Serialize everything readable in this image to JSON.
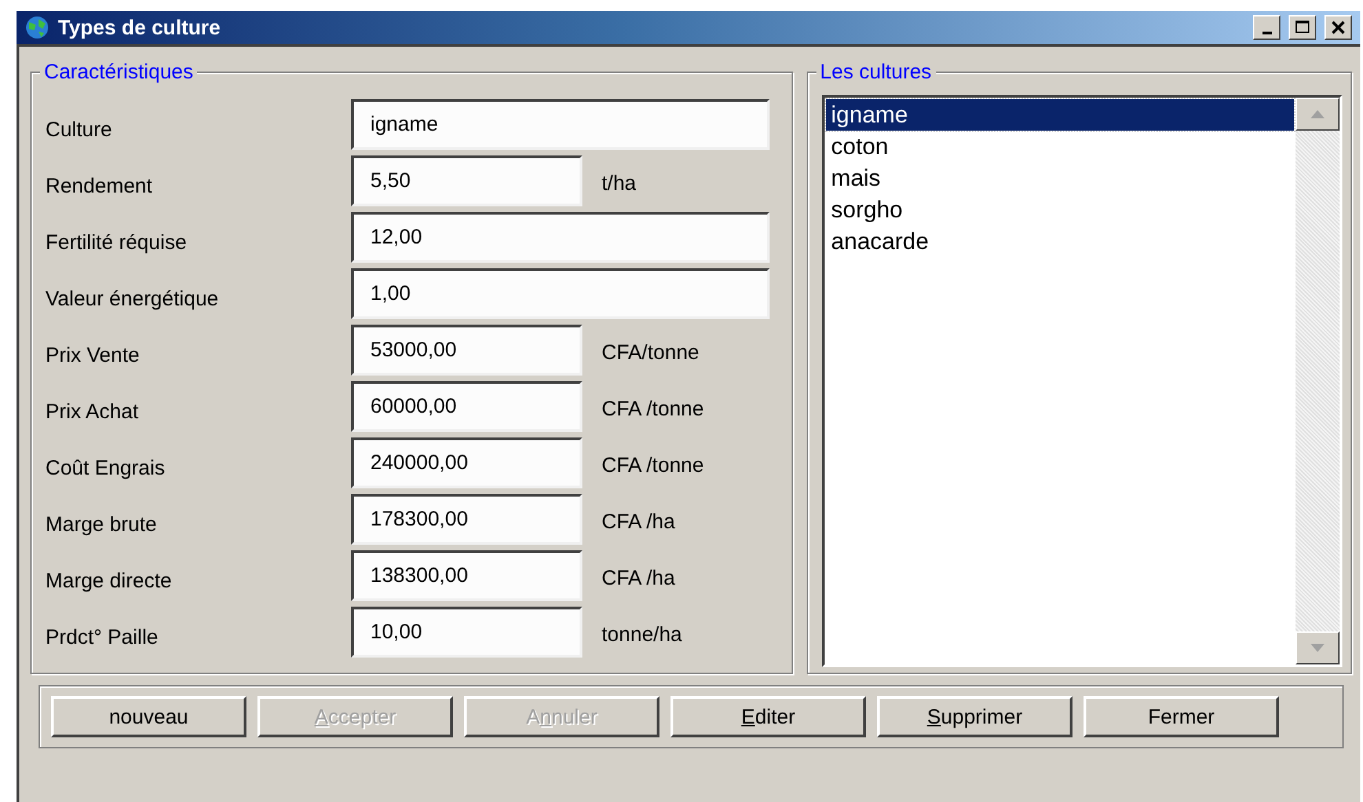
{
  "window": {
    "title": "Types de culture"
  },
  "characteristics": {
    "title": "Caractéristiques",
    "fields": [
      {
        "label": "Culture",
        "value": "igname"
      },
      {
        "label": "Rendement",
        "value": "5,50",
        "unit": "t/ha"
      },
      {
        "label": "Fertilité réquise",
        "value": "12,00"
      },
      {
        "label": "Valeur énergétique",
        "value": "1,00"
      },
      {
        "label": "Prix Vente",
        "value": "53000,00",
        "unit": "CFA/tonne"
      },
      {
        "label": "Prix Achat",
        "value": "60000,00",
        "unit": "CFA /tonne"
      },
      {
        "label": "Coût Engrais",
        "value": "240000,00",
        "unit": "CFA /tonne"
      },
      {
        "label": "Marge brute",
        "value": "178300,00",
        "unit": "CFA /ha"
      },
      {
        "label": "Marge directe",
        "value": "138300,00",
        "unit": "CFA /ha"
      },
      {
        "label": "Prdct° Paille",
        "value": "10,00",
        "unit": "tonne/ha"
      }
    ]
  },
  "cultures": {
    "title": "Les cultures",
    "items": [
      {
        "label": "igname",
        "selected": true
      },
      {
        "label": "coton",
        "selected": false
      },
      {
        "label": "mais",
        "selected": false
      },
      {
        "label": "sorgho",
        "selected": false
      },
      {
        "label": "anacarde",
        "selected": false
      }
    ]
  },
  "buttons": [
    {
      "pre": "nouveau",
      "disabled": false
    },
    {
      "key": "A",
      "post": "ccepter",
      "disabled": true
    },
    {
      "pre": "A",
      "key": "n",
      "post": "nuler",
      "disabled": true
    },
    {
      "key": "E",
      "post": "diter",
      "disabled": false
    },
    {
      "key": "S",
      "post": "upprimer",
      "disabled": false
    },
    {
      "pre": "Fermer",
      "disabled": false
    }
  ]
}
